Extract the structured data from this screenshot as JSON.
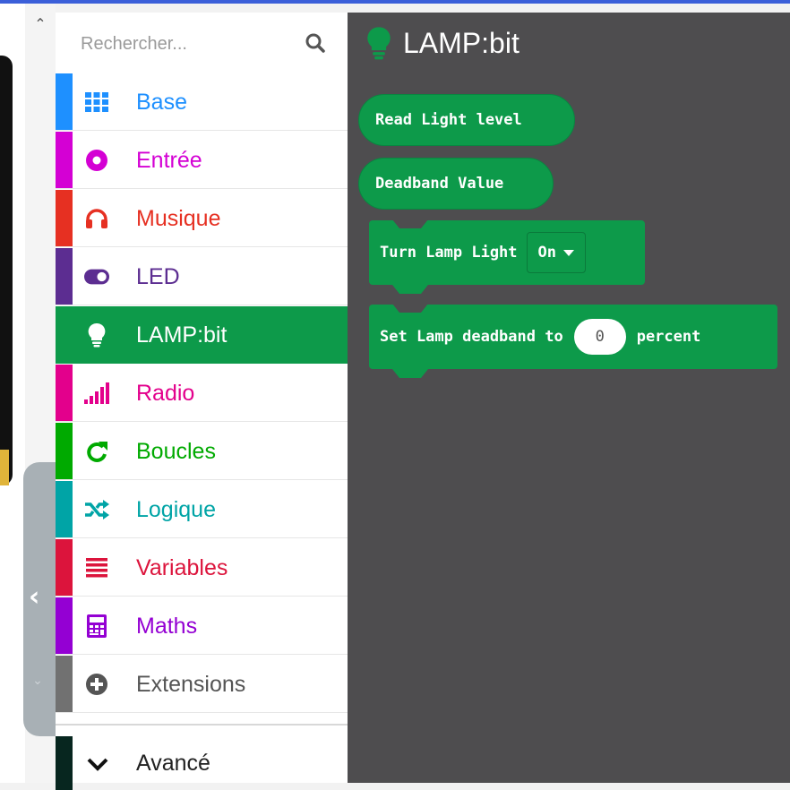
{
  "toolbox": {
    "search": {
      "placeholder": "Rechercher..."
    },
    "categories": [
      {
        "id": "base",
        "label": "Base",
        "color": "#1e90ff",
        "icon": "grid-icon"
      },
      {
        "id": "entree",
        "label": "Entrée",
        "color": "#d400d4",
        "icon": "record-icon"
      },
      {
        "id": "musique",
        "label": "Musique",
        "color": "#e63022",
        "icon": "headphones-icon"
      },
      {
        "id": "led",
        "label": "LED",
        "color": "#5c2d91",
        "icon": "toggle-icon"
      },
      {
        "id": "lampbit",
        "label": "LAMP:bit",
        "color": "#0d9a4a",
        "icon": "lightbulb-icon",
        "selected": true
      },
      {
        "id": "radio",
        "label": "Radio",
        "color": "#e3008c",
        "icon": "signal-bars-icon"
      },
      {
        "id": "boucles",
        "label": "Boucles",
        "color": "#00aa00",
        "icon": "loop-arrow-icon"
      },
      {
        "id": "logique",
        "label": "Logique",
        "color": "#00a4a6",
        "icon": "shuffle-icon"
      },
      {
        "id": "variables",
        "label": "Variables",
        "color": "#dc143c",
        "icon": "list-lines-icon"
      },
      {
        "id": "maths",
        "label": "Maths",
        "color": "#9400d3",
        "icon": "calculator-icon"
      },
      {
        "id": "extensions",
        "label": "Extensions",
        "color": "#717171",
        "icon": "plus-circle-icon"
      }
    ],
    "advanced": {
      "label": "Avancé",
      "icon": "chevron-down-icon"
    }
  },
  "flyout": {
    "title": "LAMP:bit",
    "title_icon": "lightbulb-icon",
    "color": "#0d9a4a",
    "blocks": {
      "read_light": "Read Light level",
      "deadband_value": "Deadband Value",
      "turn_lamp": {
        "label": "Turn Lamp Light",
        "dropdown_value": "On"
      },
      "set_deadband": {
        "label": "Set Lamp deadband to",
        "value": "0",
        "suffix": "percent"
      }
    }
  }
}
